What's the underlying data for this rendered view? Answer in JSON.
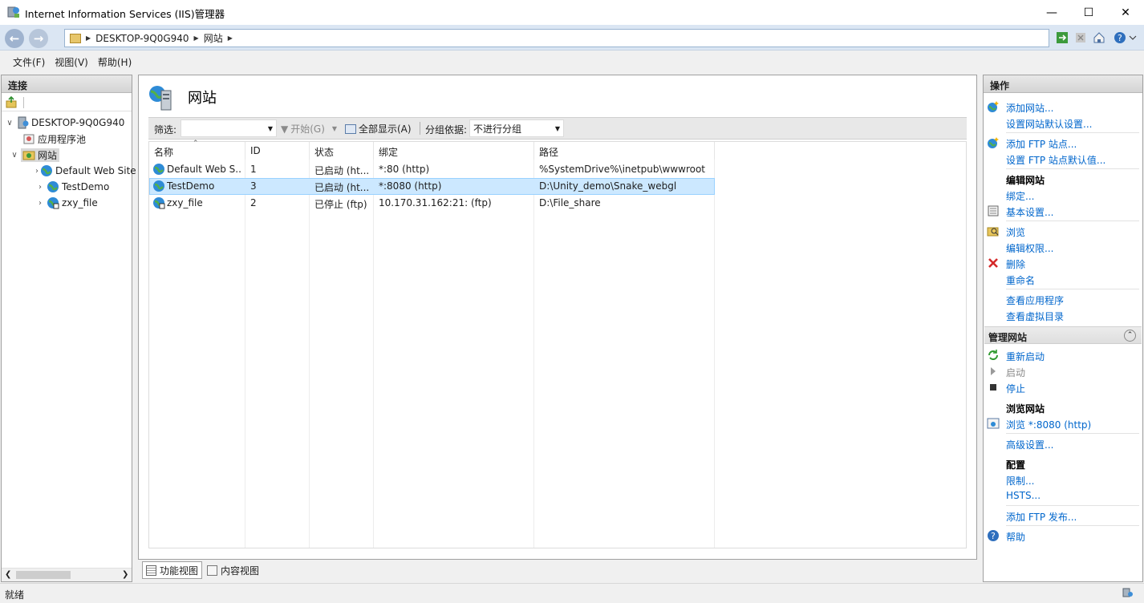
{
  "window": {
    "title": "Internet Information Services (IIS)管理器"
  },
  "address": {
    "crumbs": [
      "DESKTOP-9Q0G940",
      "网站"
    ]
  },
  "menu": {
    "items": [
      "文件(F)",
      "视图(V)",
      "帮助(H)"
    ]
  },
  "connections": {
    "title": "连接",
    "tree": {
      "server": "DESKTOP-9Q0G940",
      "app_pools": "应用程序池",
      "sites": "网站",
      "site_nodes": [
        "Default Web Site",
        "TestDemo",
        "zxy_file"
      ]
    }
  },
  "content": {
    "title": "网站",
    "filter": {
      "label": "筛选:",
      "value": "",
      "go": "开始(G)",
      "show_all": "全部显示(A)",
      "group_label": "分组依据:",
      "group_value": "不进行分组"
    },
    "columns": [
      "名称",
      "ID",
      "状态",
      "绑定",
      "路径"
    ],
    "rows": [
      {
        "name": "Default Web S...",
        "id": "1",
        "status": "已启动 (ht...",
        "binding": "*:80 (http)",
        "path": "%SystemDrive%\\inetpub\\wwwroot"
      },
      {
        "name": "TestDemo",
        "id": "3",
        "status": "已启动 (ht...",
        "binding": "*:8080 (http)",
        "path": "D:\\Unity_demo\\Snake_webgl"
      },
      {
        "name": "zxy_file",
        "id": "2",
        "status": "已停止 (ftp)",
        "binding": "10.170.31.162:21: (ftp)",
        "path": "D:\\File_share"
      }
    ],
    "view_tabs": [
      "功能视图",
      "内容视图"
    ]
  },
  "actions": {
    "title": "操作",
    "add_site": "添加网站...",
    "site_defaults": "设置网站默认设置...",
    "add_ftp": "添加 FTP 站点...",
    "ftp_defaults": "设置 FTP 站点默认值...",
    "edit_site_head": "编辑网站",
    "bindings": "绑定...",
    "basic_settings": "基本设置...",
    "explore": "浏览",
    "edit_permissions": "编辑权限...",
    "delete": "删除",
    "rename": "重命名",
    "view_apps": "查看应用程序",
    "view_vdirs": "查看虚拟目录",
    "manage_site_head": "管理网站",
    "restart": "重新启动",
    "start": "启动",
    "stop": "停止",
    "browse_site_head": "浏览网站",
    "browse_8080": "浏览 *:8080 (http)",
    "advanced": "高级设置...",
    "config_head": "配置",
    "limits": "限制...",
    "hsts": "HSTS...",
    "add_ftp_publish": "添加 FTP 发布...",
    "help": "帮助"
  },
  "status": {
    "text": "就绪"
  }
}
